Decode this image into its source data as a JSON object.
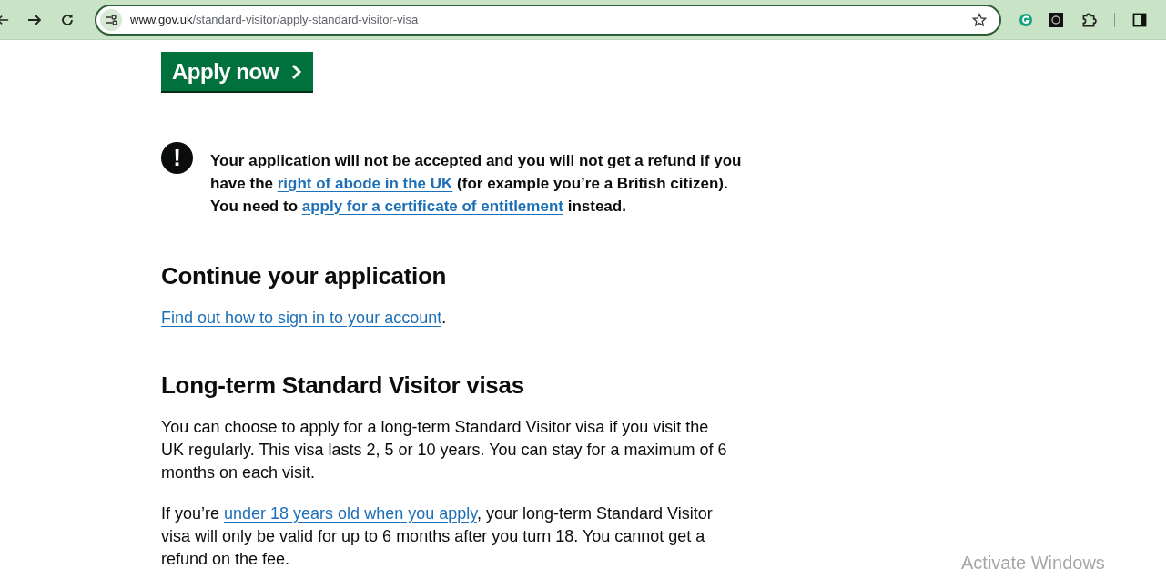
{
  "browser": {
    "url_host": "www.gov.uk",
    "url_path": "/standard-visitor/apply-standard-visitor-visa"
  },
  "apply_button": {
    "label": "Apply now"
  },
  "warning": {
    "icon_text": "!",
    "parts": [
      {
        "kind": "text",
        "text": "Your application will not be accepted and you will not get a refund if you have the "
      },
      {
        "kind": "link",
        "text": "right of abode in the UK"
      },
      {
        "kind": "text",
        "text": " (for example you’re a British citizen). You need to "
      },
      {
        "kind": "link",
        "text": "apply for a certificate of entitlement"
      },
      {
        "kind": "text",
        "text": " instead."
      }
    ]
  },
  "sections": [
    {
      "heading": "Continue your application",
      "paragraphs": [
        [
          {
            "kind": "link",
            "text": "Find out how to sign in to your account"
          },
          {
            "kind": "text",
            "text": "."
          }
        ]
      ]
    },
    {
      "heading": "Long-term Standard Visitor visas",
      "paragraphs": [
        [
          {
            "kind": "text",
            "text": "You can choose to apply for a long-term Standard Visitor visa if you visit the UK regularly. This visa lasts 2, 5 or 10 years. You can stay for a maximum of 6 months on each visit."
          }
        ],
        [
          {
            "kind": "text",
            "text": "If you’re "
          },
          {
            "kind": "link",
            "text": "under 18 years old when you apply"
          },
          {
            "kind": "text",
            "text": ", your long-term Standard Visitor visa will only be valid for up to 6 months after you turn 18. You cannot get a refund on the fee."
          }
        ]
      ]
    }
  ],
  "os_overlay": "Activate Windows"
}
